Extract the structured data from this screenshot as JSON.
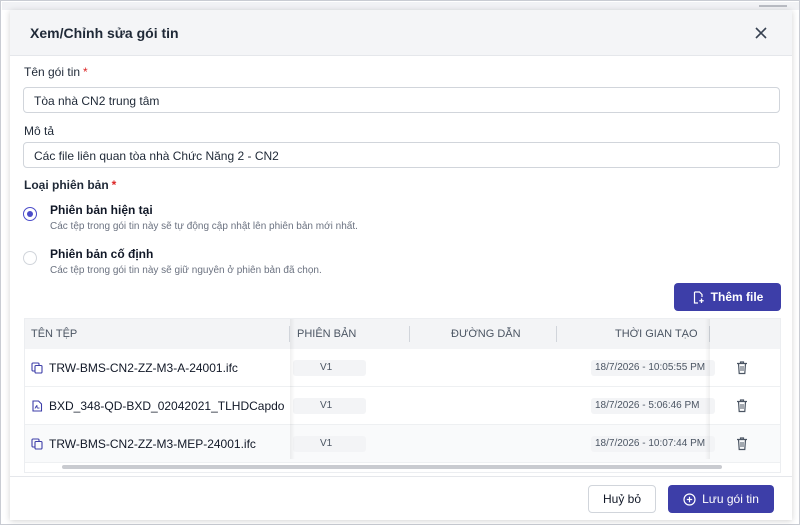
{
  "dialog": {
    "title": "Xem/Chỉnh sửa gói tin",
    "close_icon": "close-icon"
  },
  "form": {
    "name_label": "Tên gói tin",
    "name_value": "Tòa nhà CN2 trung tâm",
    "desc_label": "Mô tả",
    "desc_value": "Các file liên quan tòa nhà Chức Năng 2 - CN2",
    "version_type_label": "Loại phiên bản",
    "required_mark": "*",
    "options": [
      {
        "title": "Phiên bản hiện tại",
        "desc": "Các tệp trong gói tin này sẽ tự động cập nhật lên phiên bản mới nhất.",
        "selected": true
      },
      {
        "title": "Phiên bản cố định",
        "desc": "Các tệp trong gói tin này sẽ giữ nguyên ở phiên bản đã chọn.",
        "selected": false
      }
    ]
  },
  "add_file_label": "Thêm file",
  "table": {
    "columns": [
      "TÊN TỆP",
      "PHIÊN BẢN",
      "ĐƯỜNG DẪN",
      "THỜI GIAN TẠO"
    ],
    "rows": [
      {
        "name": "TRW-BMS-CN2-ZZ-M3-A-24001.ifc",
        "version": "V1",
        "path": "",
        "created": "18/7/2026 - 10:05:55 PM",
        "icon": "model-file-icon"
      },
      {
        "name": "BXD_348-QD-BXD_02042021_TLHDCapdo",
        "version": "V1",
        "path": "",
        "created": "18/7/2026 - 5:06:46 PM",
        "icon": "pdf-file-icon"
      },
      {
        "name": "TRW-BMS-CN2-ZZ-M3-MEP-24001.ifc",
        "version": "V1",
        "path": "",
        "created": "18/7/2026 - 10:07:44 PM",
        "icon": "model-file-icon"
      }
    ]
  },
  "footer": {
    "cancel_label": "Huỷ bỏ",
    "save_label": "Lưu gói tin"
  },
  "colors": {
    "primary": "#3d3ea8",
    "required": "#dc2626"
  }
}
